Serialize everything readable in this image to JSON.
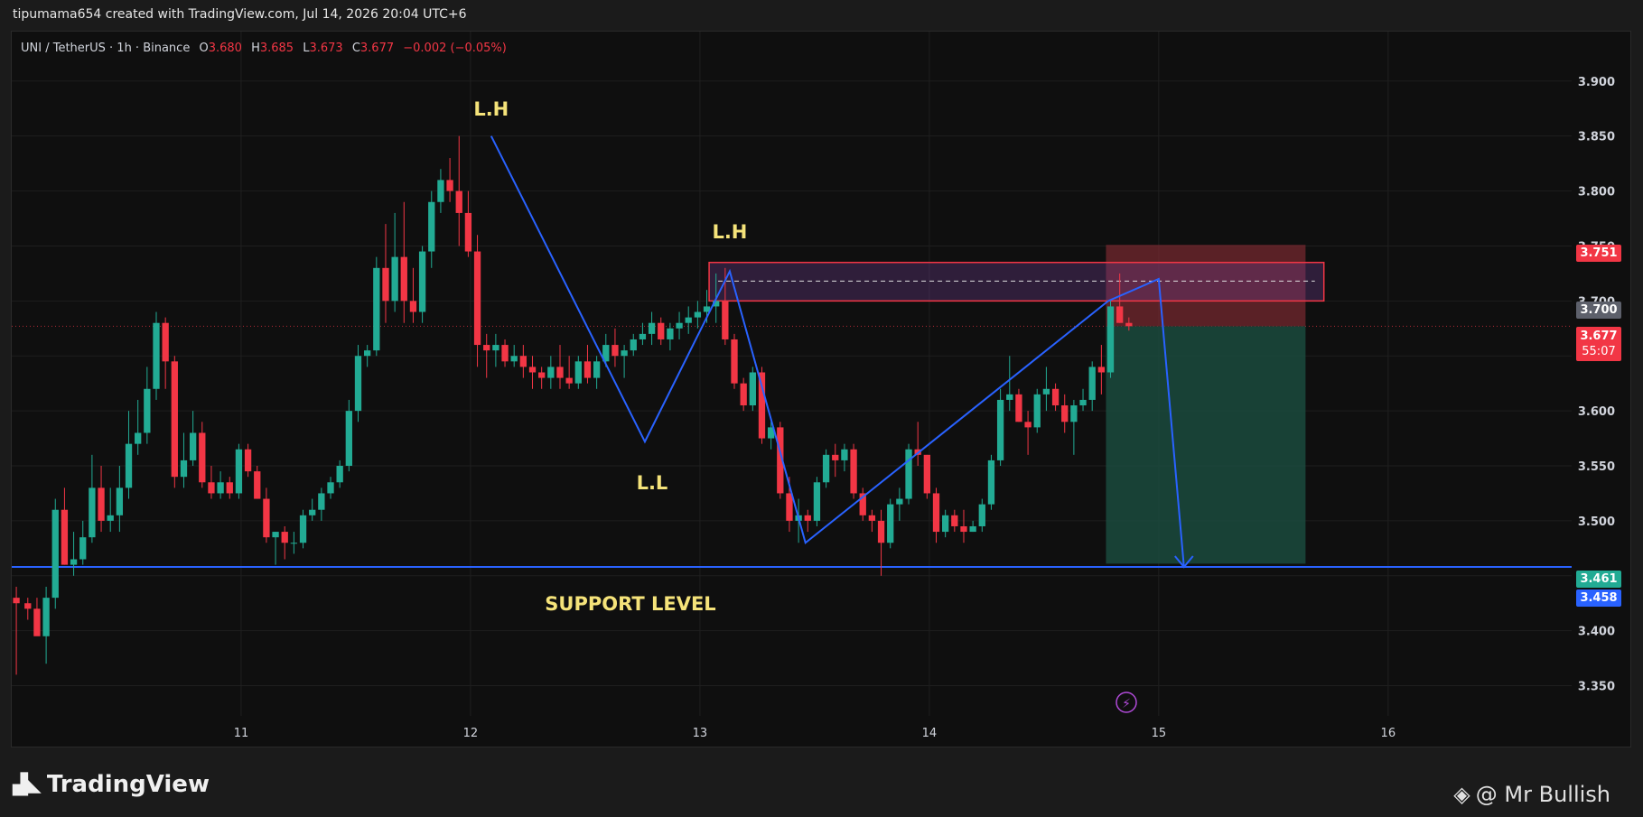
{
  "header": {
    "credit": "tipumama654 created with TradingView.com, Jul 14, 2026 20:04 UTC+6"
  },
  "symbol": {
    "name": "UNI / TetherUS · 1h · Binance",
    "o_label": "O",
    "o_value": "3.680",
    "h_label": "H",
    "h_value": "3.685",
    "l_label": "L",
    "l_value": "3.673",
    "c_label": "C",
    "c_value": "3.677",
    "change": "−0.002 (−0.05%)"
  },
  "annotations": {
    "lh1": "L.H",
    "lh2": "L.H",
    "ll": "L.L",
    "support": "SUPPORT LEVEL"
  },
  "price_tags": {
    "entry_top": "3.751",
    "level": "3.700",
    "last": "3.677",
    "countdown": "55:07",
    "target": "3.461",
    "support": "3.458"
  },
  "colors": {
    "up": "#22ab94",
    "down": "#f23645",
    "line": "#2962ff",
    "zone": "#f23645",
    "target_zone": "#1a4d40",
    "label": "#f5e37a"
  },
  "footer": {
    "brand": "TradingView",
    "author": "@ Mr Bullish"
  },
  "chart_data": {
    "type": "candlestick",
    "symbol": "UNI / TetherUS",
    "interval": "1h",
    "exchange": "Binance",
    "x_tick_labels": [
      "11",
      "12",
      "13",
      "14",
      "15",
      "16"
    ],
    "y_ticks": [
      3.35,
      3.4,
      3.45,
      3.5,
      3.55,
      3.6,
      3.65,
      3.7,
      3.75,
      3.8,
      3.85,
      3.9
    ],
    "y_tick_labels": [
      "3.350",
      "3.400",
      "3.450",
      "3.500",
      "3.550",
      "3.600",
      "3.650",
      "3.700",
      "3.750",
      "3.800",
      "3.850",
      "3.900"
    ],
    "ylim": [
      3.325,
      3.945
    ],
    "xlim": [
      10.0,
      16.8
    ],
    "candles": [
      {
        "t": 10.02,
        "o": 3.43,
        "h": 3.44,
        "l": 3.36,
        "c": 3.425
      },
      {
        "t": 10.07,
        "o": 3.425,
        "h": 3.43,
        "l": 3.41,
        "c": 3.42
      },
      {
        "t": 10.11,
        "o": 3.42,
        "h": 3.43,
        "l": 3.4,
        "c": 3.395
      },
      {
        "t": 10.15,
        "o": 3.395,
        "h": 3.44,
        "l": 3.37,
        "c": 3.43
      },
      {
        "t": 10.19,
        "o": 3.43,
        "h": 3.52,
        "l": 3.42,
        "c": 3.51
      },
      {
        "t": 10.23,
        "o": 3.51,
        "h": 3.53,
        "l": 3.46,
        "c": 3.46
      },
      {
        "t": 10.27,
        "o": 3.46,
        "h": 3.49,
        "l": 3.45,
        "c": 3.465
      },
      {
        "t": 10.31,
        "o": 3.465,
        "h": 3.5,
        "l": 3.46,
        "c": 3.485
      },
      {
        "t": 10.35,
        "o": 3.485,
        "h": 3.56,
        "l": 3.48,
        "c": 3.53
      },
      {
        "t": 10.39,
        "o": 3.53,
        "h": 3.55,
        "l": 3.49,
        "c": 3.5
      },
      {
        "t": 10.43,
        "o": 3.5,
        "h": 3.53,
        "l": 3.49,
        "c": 3.505
      },
      {
        "t": 10.47,
        "o": 3.505,
        "h": 3.55,
        "l": 3.49,
        "c": 3.53
      },
      {
        "t": 10.51,
        "o": 3.53,
        "h": 3.6,
        "l": 3.52,
        "c": 3.57
      },
      {
        "t": 10.55,
        "o": 3.57,
        "h": 3.61,
        "l": 3.56,
        "c": 3.58
      },
      {
        "t": 10.59,
        "o": 3.58,
        "h": 3.64,
        "l": 3.57,
        "c": 3.62
      },
      {
        "t": 10.63,
        "o": 3.62,
        "h": 3.69,
        "l": 3.61,
        "c": 3.68
      },
      {
        "t": 10.67,
        "o": 3.68,
        "h": 3.685,
        "l": 3.62,
        "c": 3.645
      },
      {
        "t": 10.71,
        "o": 3.645,
        "h": 3.65,
        "l": 3.53,
        "c": 3.54
      },
      {
        "t": 10.75,
        "o": 3.54,
        "h": 3.58,
        "l": 3.53,
        "c": 3.555
      },
      {
        "t": 10.79,
        "o": 3.555,
        "h": 3.6,
        "l": 3.55,
        "c": 3.58
      },
      {
        "t": 10.83,
        "o": 3.58,
        "h": 3.59,
        "l": 3.53,
        "c": 3.535
      },
      {
        "t": 10.87,
        "o": 3.535,
        "h": 3.55,
        "l": 3.52,
        "c": 3.525
      },
      {
        "t": 10.91,
        "o": 3.525,
        "h": 3.545,
        "l": 3.52,
        "c": 3.535
      },
      {
        "t": 10.95,
        "o": 3.535,
        "h": 3.54,
        "l": 3.52,
        "c": 3.525
      },
      {
        "t": 10.99,
        "o": 3.525,
        "h": 3.57,
        "l": 3.52,
        "c": 3.565
      },
      {
        "t": 11.03,
        "o": 3.565,
        "h": 3.57,
        "l": 3.54,
        "c": 3.545
      },
      {
        "t": 11.07,
        "o": 3.545,
        "h": 3.55,
        "l": 3.52,
        "c": 3.52
      },
      {
        "t": 11.11,
        "o": 3.52,
        "h": 3.53,
        "l": 3.48,
        "c": 3.485
      },
      {
        "t": 11.15,
        "o": 3.485,
        "h": 3.49,
        "l": 3.46,
        "c": 3.49
      },
      {
        "t": 11.19,
        "o": 3.49,
        "h": 3.495,
        "l": 3.465,
        "c": 3.48
      },
      {
        "t": 11.23,
        "o": 3.48,
        "h": 3.49,
        "l": 3.47,
        "c": 3.48
      },
      {
        "t": 11.27,
        "o": 3.48,
        "h": 3.51,
        "l": 3.475,
        "c": 3.505
      },
      {
        "t": 11.31,
        "o": 3.505,
        "h": 3.52,
        "l": 3.5,
        "c": 3.51
      },
      {
        "t": 11.35,
        "o": 3.51,
        "h": 3.53,
        "l": 3.5,
        "c": 3.525
      },
      {
        "t": 11.39,
        "o": 3.525,
        "h": 3.54,
        "l": 3.52,
        "c": 3.535
      },
      {
        "t": 11.43,
        "o": 3.535,
        "h": 3.555,
        "l": 3.53,
        "c": 3.55
      },
      {
        "t": 11.47,
        "o": 3.55,
        "h": 3.61,
        "l": 3.545,
        "c": 3.6
      },
      {
        "t": 11.51,
        "o": 3.6,
        "h": 3.66,
        "l": 3.59,
        "c": 3.65
      },
      {
        "t": 11.55,
        "o": 3.65,
        "h": 3.66,
        "l": 3.64,
        "c": 3.655
      },
      {
        "t": 11.59,
        "o": 3.655,
        "h": 3.74,
        "l": 3.65,
        "c": 3.73
      },
      {
        "t": 11.63,
        "o": 3.73,
        "h": 3.77,
        "l": 3.68,
        "c": 3.7
      },
      {
        "t": 11.67,
        "o": 3.7,
        "h": 3.78,
        "l": 3.69,
        "c": 3.74
      },
      {
        "t": 11.71,
        "o": 3.74,
        "h": 3.79,
        "l": 3.68,
        "c": 3.7
      },
      {
        "t": 11.75,
        "o": 3.7,
        "h": 3.73,
        "l": 3.68,
        "c": 3.69
      },
      {
        "t": 11.79,
        "o": 3.69,
        "h": 3.75,
        "l": 3.68,
        "c": 3.745
      },
      {
        "t": 11.83,
        "o": 3.745,
        "h": 3.8,
        "l": 3.73,
        "c": 3.79
      },
      {
        "t": 11.87,
        "o": 3.79,
        "h": 3.82,
        "l": 3.78,
        "c": 3.81
      },
      {
        "t": 11.91,
        "o": 3.81,
        "h": 3.83,
        "l": 3.79,
        "c": 3.8
      },
      {
        "t": 11.95,
        "o": 3.8,
        "h": 3.85,
        "l": 3.75,
        "c": 3.78
      },
      {
        "t": 11.99,
        "o": 3.78,
        "h": 3.8,
        "l": 3.74,
        "c": 3.745
      },
      {
        "t": 12.03,
        "o": 3.745,
        "h": 3.76,
        "l": 3.64,
        "c": 3.66
      },
      {
        "t": 12.07,
        "o": 3.66,
        "h": 3.67,
        "l": 3.63,
        "c": 3.655
      },
      {
        "t": 12.11,
        "o": 3.655,
        "h": 3.67,
        "l": 3.64,
        "c": 3.66
      },
      {
        "t": 12.15,
        "o": 3.66,
        "h": 3.665,
        "l": 3.64,
        "c": 3.645
      },
      {
        "t": 12.19,
        "o": 3.645,
        "h": 3.66,
        "l": 3.64,
        "c": 3.65
      },
      {
        "t": 12.23,
        "o": 3.65,
        "h": 3.66,
        "l": 3.63,
        "c": 3.64
      },
      {
        "t": 12.27,
        "o": 3.64,
        "h": 3.65,
        "l": 3.62,
        "c": 3.635
      },
      {
        "t": 12.31,
        "o": 3.635,
        "h": 3.64,
        "l": 3.62,
        "c": 3.63
      },
      {
        "t": 12.35,
        "o": 3.63,
        "h": 3.65,
        "l": 3.62,
        "c": 3.64
      },
      {
        "t": 12.39,
        "o": 3.64,
        "h": 3.66,
        "l": 3.62,
        "c": 3.63
      },
      {
        "t": 12.43,
        "o": 3.63,
        "h": 3.65,
        "l": 3.62,
        "c": 3.625
      },
      {
        "t": 12.47,
        "o": 3.625,
        "h": 3.65,
        "l": 3.62,
        "c": 3.645
      },
      {
        "t": 12.51,
        "o": 3.645,
        "h": 3.66,
        "l": 3.625,
        "c": 3.63
      },
      {
        "t": 12.55,
        "o": 3.63,
        "h": 3.65,
        "l": 3.62,
        "c": 3.645
      },
      {
        "t": 12.59,
        "o": 3.645,
        "h": 3.67,
        "l": 3.64,
        "c": 3.66
      },
      {
        "t": 12.63,
        "o": 3.66,
        "h": 3.675,
        "l": 3.64,
        "c": 3.65
      },
      {
        "t": 12.67,
        "o": 3.65,
        "h": 3.66,
        "l": 3.63,
        "c": 3.655
      },
      {
        "t": 12.71,
        "o": 3.655,
        "h": 3.67,
        "l": 3.65,
        "c": 3.665
      },
      {
        "t": 12.75,
        "o": 3.665,
        "h": 3.68,
        "l": 3.66,
        "c": 3.67
      },
      {
        "t": 12.79,
        "o": 3.67,
        "h": 3.69,
        "l": 3.66,
        "c": 3.68
      },
      {
        "t": 12.83,
        "o": 3.68,
        "h": 3.685,
        "l": 3.66,
        "c": 3.665
      },
      {
        "t": 12.87,
        "o": 3.665,
        "h": 3.68,
        "l": 3.655,
        "c": 3.675
      },
      {
        "t": 12.91,
        "o": 3.675,
        "h": 3.69,
        "l": 3.665,
        "c": 3.68
      },
      {
        "t": 12.95,
        "o": 3.68,
        "h": 3.695,
        "l": 3.67,
        "c": 3.685
      },
      {
        "t": 12.99,
        "o": 3.685,
        "h": 3.7,
        "l": 3.675,
        "c": 3.69
      },
      {
        "t": 13.03,
        "o": 3.69,
        "h": 3.71,
        "l": 3.68,
        "c": 3.695
      },
      {
        "t": 13.07,
        "o": 3.695,
        "h": 3.725,
        "l": 3.68,
        "c": 3.7
      },
      {
        "t": 13.11,
        "o": 3.7,
        "h": 3.73,
        "l": 3.66,
        "c": 3.665
      },
      {
        "t": 13.15,
        "o": 3.665,
        "h": 3.67,
        "l": 3.62,
        "c": 3.625
      },
      {
        "t": 13.19,
        "o": 3.625,
        "h": 3.63,
        "l": 3.6,
        "c": 3.605
      },
      {
        "t": 13.23,
        "o": 3.605,
        "h": 3.64,
        "l": 3.6,
        "c": 3.635
      },
      {
        "t": 13.27,
        "o": 3.635,
        "h": 3.64,
        "l": 3.57,
        "c": 3.575
      },
      {
        "t": 13.31,
        "o": 3.575,
        "h": 3.59,
        "l": 3.565,
        "c": 3.585
      },
      {
        "t": 13.35,
        "o": 3.585,
        "h": 3.59,
        "l": 3.52,
        "c": 3.525
      },
      {
        "t": 13.39,
        "o": 3.525,
        "h": 3.54,
        "l": 3.49,
        "c": 3.5
      },
      {
        "t": 13.43,
        "o": 3.5,
        "h": 3.52,
        "l": 3.48,
        "c": 3.505
      },
      {
        "t": 13.47,
        "o": 3.505,
        "h": 3.51,
        "l": 3.49,
        "c": 3.5
      },
      {
        "t": 13.51,
        "o": 3.5,
        "h": 3.54,
        "l": 3.495,
        "c": 3.535
      },
      {
        "t": 13.55,
        "o": 3.535,
        "h": 3.565,
        "l": 3.53,
        "c": 3.56
      },
      {
        "t": 13.59,
        "o": 3.56,
        "h": 3.57,
        "l": 3.54,
        "c": 3.555
      },
      {
        "t": 13.63,
        "o": 3.555,
        "h": 3.57,
        "l": 3.545,
        "c": 3.565
      },
      {
        "t": 13.67,
        "o": 3.565,
        "h": 3.57,
        "l": 3.52,
        "c": 3.525
      },
      {
        "t": 13.71,
        "o": 3.525,
        "h": 3.53,
        "l": 3.5,
        "c": 3.505
      },
      {
        "t": 13.75,
        "o": 3.505,
        "h": 3.51,
        "l": 3.49,
        "c": 3.5
      },
      {
        "t": 13.79,
        "o": 3.5,
        "h": 3.51,
        "l": 3.45,
        "c": 3.48
      },
      {
        "t": 13.83,
        "o": 3.48,
        "h": 3.52,
        "l": 3.475,
        "c": 3.515
      },
      {
        "t": 13.87,
        "o": 3.515,
        "h": 3.53,
        "l": 3.5,
        "c": 3.52
      },
      {
        "t": 13.91,
        "o": 3.52,
        "h": 3.57,
        "l": 3.515,
        "c": 3.565
      },
      {
        "t": 13.95,
        "o": 3.565,
        "h": 3.59,
        "l": 3.55,
        "c": 3.56
      },
      {
        "t": 13.99,
        "o": 3.56,
        "h": 3.56,
        "l": 3.52,
        "c": 3.525
      },
      {
        "t": 14.03,
        "o": 3.525,
        "h": 3.53,
        "l": 3.48,
        "c": 3.49
      },
      {
        "t": 14.07,
        "o": 3.49,
        "h": 3.51,
        "l": 3.485,
        "c": 3.505
      },
      {
        "t": 14.11,
        "o": 3.505,
        "h": 3.51,
        "l": 3.49,
        "c": 3.495
      },
      {
        "t": 14.15,
        "o": 3.495,
        "h": 3.51,
        "l": 3.48,
        "c": 3.49
      },
      {
        "t": 14.19,
        "o": 3.49,
        "h": 3.5,
        "l": 3.49,
        "c": 3.495
      },
      {
        "t": 14.23,
        "o": 3.495,
        "h": 3.52,
        "l": 3.49,
        "c": 3.515
      },
      {
        "t": 14.27,
        "o": 3.515,
        "h": 3.56,
        "l": 3.51,
        "c": 3.555
      },
      {
        "t": 14.31,
        "o": 3.555,
        "h": 3.62,
        "l": 3.55,
        "c": 3.61
      },
      {
        "t": 14.35,
        "o": 3.61,
        "h": 3.65,
        "l": 3.6,
        "c": 3.615
      },
      {
        "t": 14.39,
        "o": 3.615,
        "h": 3.62,
        "l": 3.59,
        "c": 3.59
      },
      {
        "t": 14.43,
        "o": 3.59,
        "h": 3.6,
        "l": 3.56,
        "c": 3.585
      },
      {
        "t": 14.47,
        "o": 3.585,
        "h": 3.62,
        "l": 3.58,
        "c": 3.615
      },
      {
        "t": 14.51,
        "o": 3.615,
        "h": 3.64,
        "l": 3.6,
        "c": 3.62
      },
      {
        "t": 14.55,
        "o": 3.62,
        "h": 3.625,
        "l": 3.6,
        "c": 3.605
      },
      {
        "t": 14.59,
        "o": 3.605,
        "h": 3.615,
        "l": 3.58,
        "c": 3.59
      },
      {
        "t": 14.63,
        "o": 3.59,
        "h": 3.61,
        "l": 3.56,
        "c": 3.605
      },
      {
        "t": 14.67,
        "o": 3.605,
        "h": 3.62,
        "l": 3.6,
        "c": 3.61
      },
      {
        "t": 14.71,
        "o": 3.61,
        "h": 3.645,
        "l": 3.6,
        "c": 3.64
      },
      {
        "t": 14.75,
        "o": 3.64,
        "h": 3.66,
        "l": 3.615,
        "c": 3.635
      },
      {
        "t": 14.79,
        "o": 3.635,
        "h": 3.7,
        "l": 3.63,
        "c": 3.695
      },
      {
        "t": 14.83,
        "o": 3.695,
        "h": 3.725,
        "l": 3.68,
        "c": 3.68
      },
      {
        "t": 14.87,
        "o": 3.68,
        "h": 3.685,
        "l": 3.673,
        "c": 3.677
      }
    ],
    "support_level": 3.458,
    "target_level": 3.461,
    "resistance_zone": [
      3.7,
      3.735
    ],
    "zone_mid": 3.718,
    "short_entry_top": 3.751,
    "last_price": 3.677,
    "zigzag": [
      {
        "t": 12.09,
        "p": 3.85
      },
      {
        "t": 12.76,
        "p": 3.572
      },
      {
        "t": 13.13,
        "p": 3.727
      },
      {
        "t": 13.46,
        "p": 3.48
      },
      {
        "t": 14.78,
        "p": 3.7
      },
      {
        "t": 15.0,
        "p": 3.72
      },
      {
        "t": 15.11,
        "p": 3.458
      }
    ]
  }
}
